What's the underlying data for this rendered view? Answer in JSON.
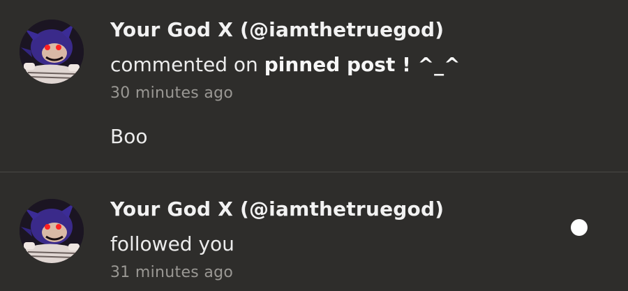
{
  "notifications": [
    {
      "author": "Your God X (@iamthetruegod)",
      "action_prefix": "commented on ",
      "post_title": "pinned post ! ^_^",
      "timestamp": "30 minutes ago",
      "comment": "Boo",
      "avatar_icon": "sonic-exe-avatar"
    },
    {
      "author": "Your God X (@iamthetruegod)",
      "action": "followed you",
      "timestamp": "31 minutes ago",
      "avatar_icon": "sonic-exe-avatar",
      "unread": true
    }
  ],
  "colors": {
    "background": "#2e2d2b",
    "text_primary": "#f2f2f2",
    "text_secondary": "#9a9894",
    "divider": "#4a4946",
    "unread_dot": "#ffffff"
  }
}
